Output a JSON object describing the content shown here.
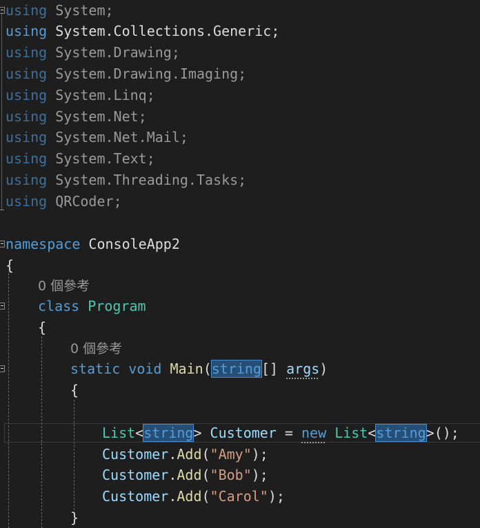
{
  "code": {
    "usings": [
      {
        "keyword": "using",
        "ns": "System",
        "end": ";"
      },
      {
        "keyword": "using",
        "ns": "System.Collections.Generic",
        "end": ";"
      },
      {
        "keyword": "using",
        "ns": "System.Drawing",
        "end": ";"
      },
      {
        "keyword": "using",
        "ns": "System.Drawing.Imaging",
        "end": ";"
      },
      {
        "keyword": "using",
        "ns": "System.Linq",
        "end": ";"
      },
      {
        "keyword": "using",
        "ns": "System.Net",
        "end": ";"
      },
      {
        "keyword": "using",
        "ns": "System.Net.Mail",
        "end": ";"
      },
      {
        "keyword": "using",
        "ns": "System.Text",
        "end": ";"
      },
      {
        "keyword": "using",
        "ns": "System.Threading.Tasks",
        "end": ";"
      },
      {
        "keyword": "using",
        "ns": "QRCoder",
        "end": ";"
      }
    ],
    "namespace_keyword": "namespace",
    "namespace_name": "ConsoleApp2",
    "open_brace": "{",
    "close_brace": "}",
    "class_refs": "0 個參考",
    "class_keyword": "class",
    "class_name": "Program",
    "method_refs": "0 個參考",
    "method_static": "static",
    "method_void": "void",
    "method_name": "Main",
    "method_open_paren": "(",
    "method_param_type": "string",
    "method_param_brackets": "[] ",
    "method_param_name": "args",
    "method_close_paren": ")",
    "decl": {
      "list1": "List",
      "lt1": "<",
      "string1": "string",
      "gt1": ">",
      "var": " Customer",
      "assign": " = ",
      "new_kw": "new",
      "space": " ",
      "list2": "List",
      "lt2": "<",
      "string2": "string",
      "gt2": ">",
      "tail": "();"
    },
    "calls": [
      {
        "obj": "Customer",
        "dot": ".",
        "method": "Add",
        "open": "(",
        "arg": "\"Amy\"",
        "close": ");"
      },
      {
        "obj": "Customer",
        "dot": ".",
        "method": "Add",
        "open": "(",
        "arg": "\"Bob\"",
        "close": ");"
      },
      {
        "obj": "Customer",
        "dot": ".",
        "method": "Add",
        "open": "(",
        "arg": "\"Carol\"",
        "close": ");"
      }
    ]
  },
  "colors": {
    "background": "#1e1e1e",
    "keyword": "#569cd6",
    "type": "#4ec9b0",
    "method": "#dcdcaa",
    "string": "#d69d85",
    "highlight": "#264f78"
  }
}
